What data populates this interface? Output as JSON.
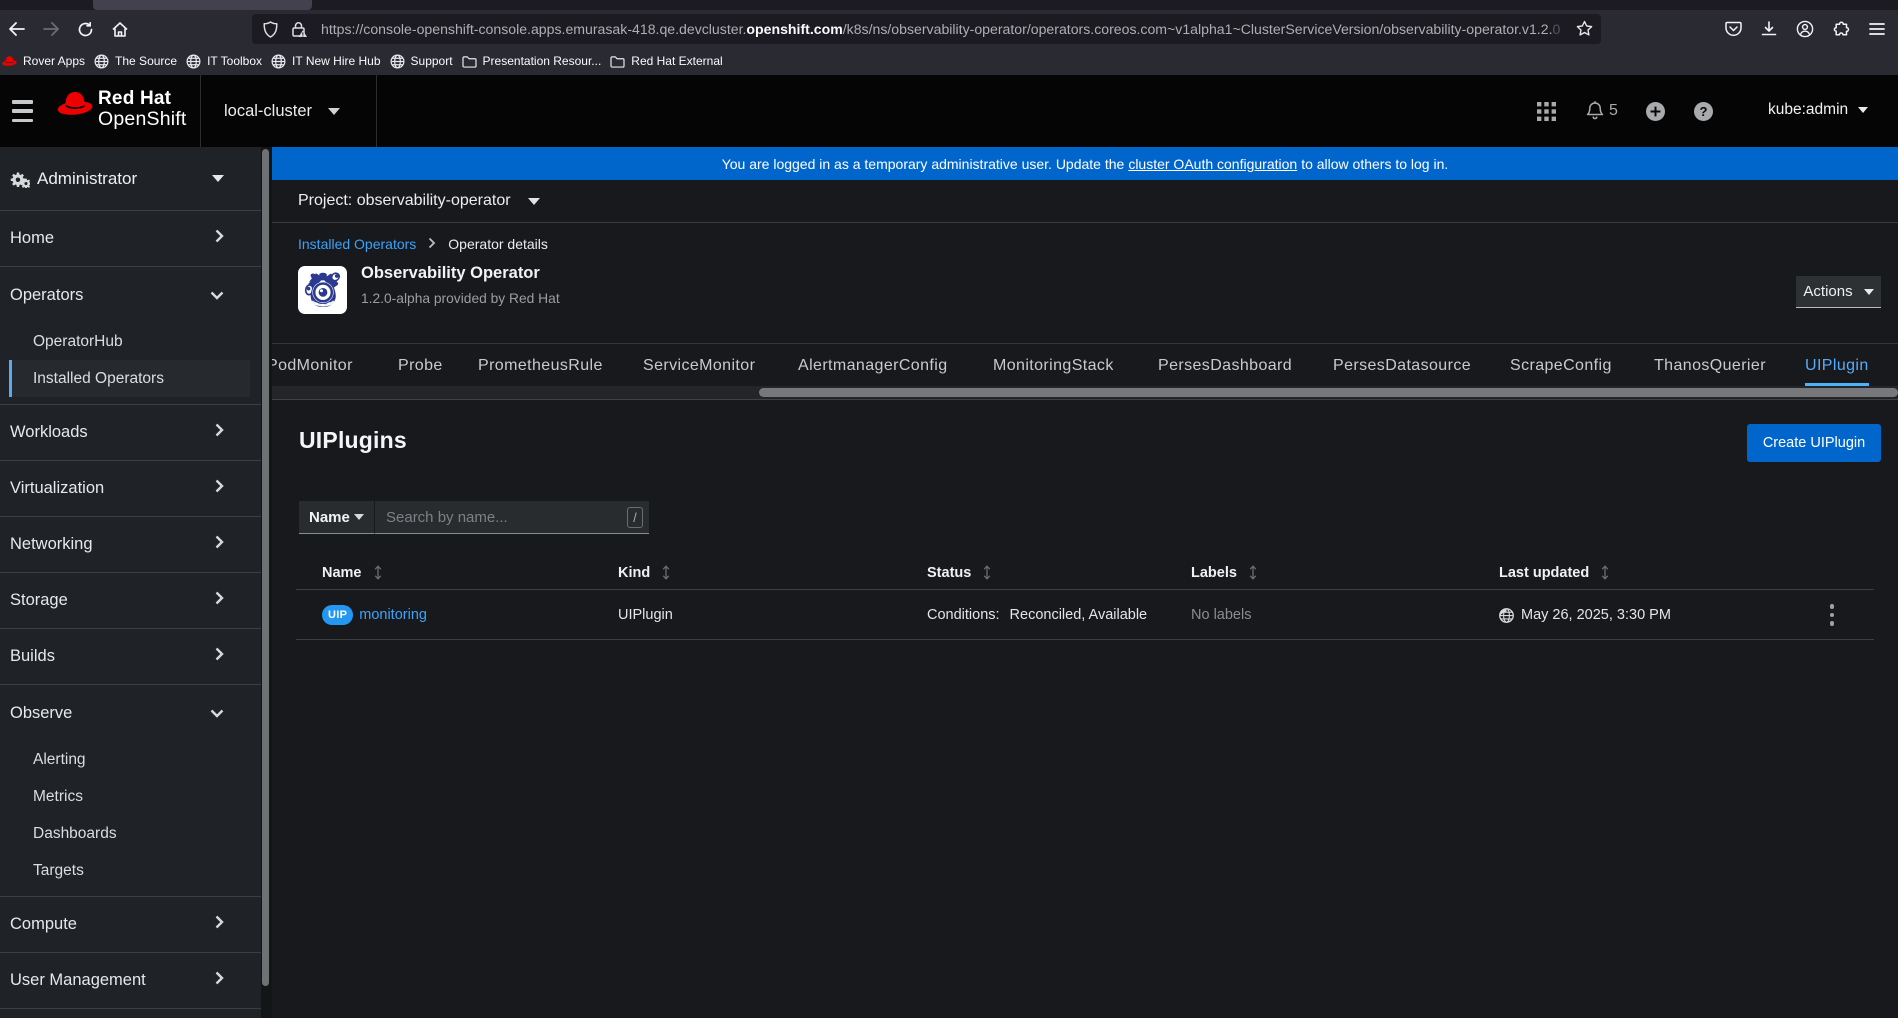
{
  "browser": {
    "back_tooltip": "back",
    "url": {
      "prefix": "https://console-openshift-console.apps.emurasak-418.qe.devcluster.",
      "domain": "openshift.com",
      "path": "/k8s/ns/observability-operator/operators.coreos.com~v1alpha1~ClusterServiceVersion/observability-operator.v1.2.",
      "path_fade": "0"
    },
    "bookmarks": [
      {
        "label": "Rover Apps",
        "icon": "redhat-icon"
      },
      {
        "label": "The Source",
        "icon": "globe-icon"
      },
      {
        "label": "IT Toolbox",
        "icon": "globe-icon"
      },
      {
        "label": "IT New Hire Hub",
        "icon": "globe-icon"
      },
      {
        "label": "Support",
        "icon": "globe-icon"
      },
      {
        "label": "Presentation Resour...",
        "icon": "folder-icon"
      },
      {
        "label": "Red Hat External",
        "icon": "folder-icon"
      }
    ]
  },
  "masthead": {
    "brand_line1": "Red Hat",
    "brand_line2": "OpenShift",
    "cluster_selector": "local-cluster",
    "notification_count": "5",
    "username": "kube:admin"
  },
  "banner": {
    "text_before": "You are logged in as a temporary administrative user. Update the",
    "link_text": "cluster OAuth configuration",
    "text_after": "to allow others to log in."
  },
  "project_bar": {
    "label": "Project: observability-operator"
  },
  "breadcrumb": {
    "link": "Installed Operators",
    "current": "Operator details"
  },
  "operator": {
    "name": "Observability Operator",
    "subtitle": "1.2.0-alpha provided by Red Hat",
    "actions_label": "Actions"
  },
  "tabs": {
    "items": [
      "PodMonitor",
      "Probe",
      "PrometheusRule",
      "ServiceMonitor",
      "AlertmanagerConfig",
      "MonitoringStack",
      "PersesDashboard",
      "PersesDatasource",
      "ScrapeConfig",
      "ThanosQuerier",
      "UIPlugin"
    ],
    "active": "UIPlugin"
  },
  "list_page": {
    "title": "UIPlugins",
    "create_button": "Create UIPlugin",
    "filter": {
      "dropdown": "Name",
      "placeholder": "Search by name...",
      "shortcut": "/"
    },
    "table": {
      "columns": [
        "Name",
        "Kind",
        "Status",
        "Labels",
        "Last updated"
      ],
      "row": {
        "badge": "UIP",
        "name": "monitoring",
        "kind": "UIPlugin",
        "status_label": "Conditions:",
        "status_value": "Reconciled, Available",
        "labels": "No labels",
        "last_updated": "May 26, 2025, 3:30 PM"
      }
    }
  },
  "sidebar": {
    "perspective": "Administrator",
    "items": [
      {
        "label": "Home"
      },
      {
        "label": "Operators"
      },
      {
        "label": "Workloads"
      },
      {
        "label": "Virtualization"
      },
      {
        "label": "Networking"
      },
      {
        "label": "Storage"
      },
      {
        "label": "Builds"
      },
      {
        "label": "Observe"
      },
      {
        "label": "Compute"
      },
      {
        "label": "User Management"
      }
    ],
    "operators_children": [
      {
        "label": "OperatorHub"
      },
      {
        "label": "Installed Operators"
      }
    ],
    "observe_children": [
      {
        "label": "Alerting"
      },
      {
        "label": "Metrics"
      },
      {
        "label": "Dashboards"
      },
      {
        "label": "Targets"
      }
    ]
  },
  "colors": {
    "accent_blue": "#0066cc",
    "link_blue": "#3ba3f7",
    "banner_blue": "#0066cc",
    "badge_blue": "#2397f2"
  }
}
